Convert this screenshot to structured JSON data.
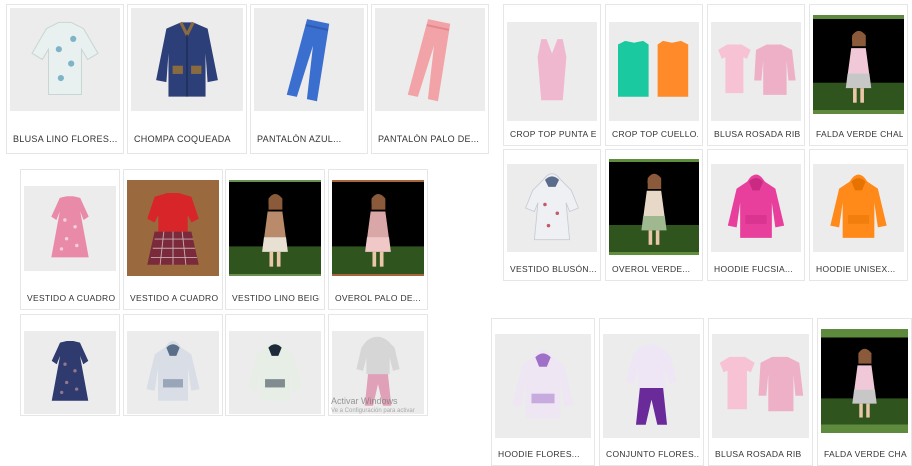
{
  "groups": {
    "top_left": [
      {
        "label": "BLUSA LINO FLORES...",
        "bg": "#ececec",
        "fill": "#e8f1ef",
        "accent": "#7fb3c8",
        "shape": "blouse"
      },
      {
        "label": "CHOMPA COQUEADA",
        "bg": "#ececec",
        "fill": "#2c3f78",
        "accent": "#8a6b3f",
        "shape": "jacket"
      },
      {
        "label": "PANTALÓN AZUL...",
        "bg": "#ececec",
        "fill": "#3a6fcf",
        "accent": "#2e5cb0",
        "shape": "pants"
      },
      {
        "label": "PANTALÓN PALO DE...",
        "bg": "#ececec",
        "fill": "#f2a3a8",
        "accent": "#e5888e",
        "shape": "pants"
      }
    ],
    "top_right": [
      {
        "label": "CROP TOP PUNTA EN V",
        "bg": "#ececec",
        "fill": "#f0b8cf",
        "accent": "#e0a0bb",
        "shape": "tank"
      },
      {
        "label": "CROP TOP CUELLO...",
        "bg": "#ececec",
        "fill": "#1ac9a0",
        "accent": "#ff8a2a",
        "shape": "twotank"
      },
      {
        "label": "BLUSA ROSADA RIB",
        "bg": "#ececec",
        "fill": "#f6c2d4",
        "accent": "#eeb0c6",
        "shape": "twotee"
      },
      {
        "label": "FALDA VERDE CHALIS",
        "bg": "#5d8a3d",
        "fill": "#c7c7c7",
        "accent": "#f0c8d8",
        "shape": "photo"
      }
    ],
    "middle_left": [
      {
        "label": "VESTIDO A CUADROS...",
        "bg": "#ececec",
        "fill": "#e98aa9",
        "accent": "#ffffff",
        "shape": "dress"
      },
      {
        "label": "VESTIDO A CUADROS...",
        "bg": "#9a6a3e",
        "fill": "#d8252a",
        "accent": "#7a2a3a",
        "shape": "reddress"
      },
      {
        "label": "VESTIDO LINO BEIGE...",
        "bg": "#6a8f52",
        "fill": "#e8e0d2",
        "accent": "#b98b6a",
        "shape": "photo"
      },
      {
        "label": "OVEROL PALO DE...",
        "bg": "#a8643c",
        "fill": "#f0c8c8",
        "accent": "#d9a7a7",
        "shape": "photo"
      }
    ],
    "middle_right": [
      {
        "label": "VESTIDO BLUSÓN...",
        "bg": "#ececec",
        "fill": "#eef0f3",
        "accent": "#5a6b8c",
        "shape": "hoodiedress"
      },
      {
        "label": "OVEROL VERDE...",
        "bg": "#5f8e3c",
        "fill": "#9fb890",
        "accent": "#e8d8c8",
        "shape": "photo"
      },
      {
        "label": "HOODIE FUCSIA...",
        "bg": "#ececec",
        "fill": "#e83e9c",
        "accent": "#c92a82",
        "shape": "hoodie"
      },
      {
        "label": "HOODIE UNISEX...",
        "bg": "#ececec",
        "fill": "#ff8a1a",
        "accent": "#e67200",
        "shape": "hoodie"
      }
    ],
    "bottom_left": [
      {
        "label": "",
        "bg": "#ececec",
        "fill": "#2f3a6e",
        "accent": "#d8a0a0",
        "shape": "dress"
      },
      {
        "label": "",
        "bg": "#ececec",
        "fill": "#d8dde6",
        "accent": "#5a6e8a",
        "shape": "hoodie"
      },
      {
        "label": "",
        "bg": "#ececec",
        "fill": "#e6eee6",
        "accent": "#1c2a3a",
        "shape": "hoodie"
      },
      {
        "label": "",
        "bg": "#ececec",
        "fill": "#d6d6d6",
        "accent": "#e0a0b8",
        "shape": "set"
      }
    ],
    "bottom_right": [
      {
        "label": "HOODIE FLORES...",
        "bg": "#ececec",
        "fill": "#efe6f4",
        "accent": "#a070c8",
        "shape": "hoodie"
      },
      {
        "label": "CONJUNTO FLORES...",
        "bg": "#ececec",
        "fill": "#eee6f4",
        "accent": "#6a2a9a",
        "shape": "set"
      },
      {
        "label": "BLUSA ROSADA RIB",
        "bg": "#ececec",
        "fill": "#f6c2d4",
        "accent": "#eeb0c6",
        "shape": "twotee"
      },
      {
        "label": "FALDA VERDE CHALIS",
        "bg": "#5d8a3d",
        "fill": "#c7c7c7",
        "accent": "#f0c8d8",
        "shape": "photo"
      }
    ]
  },
  "watermark": {
    "title": "Activar Windows",
    "subtitle": "Ve a Configuración para activar"
  }
}
